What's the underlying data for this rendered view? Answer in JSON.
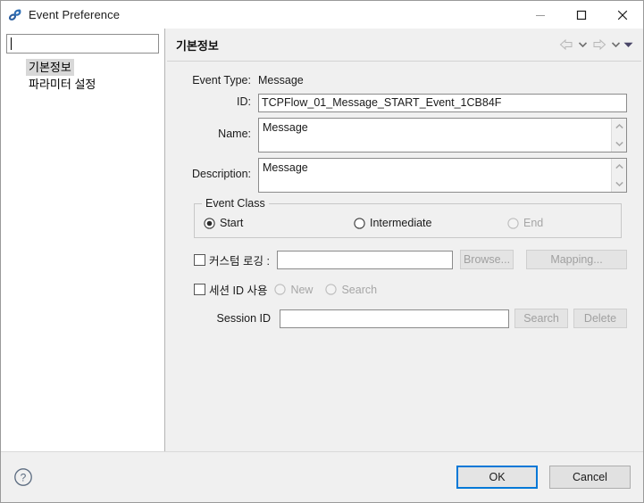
{
  "window": {
    "title": "Event Preference",
    "app_icon": "links-icon",
    "controls": {
      "minimize": "minimize-icon",
      "maximize": "maximize-icon",
      "close": "close-icon"
    }
  },
  "sidebar": {
    "filter_value": "",
    "filter_placeholder": "",
    "items": [
      {
        "label": "기본정보",
        "selected": true
      },
      {
        "label": "파라미터 설정",
        "selected": false
      }
    ]
  },
  "content": {
    "header_title": "기본정보",
    "nav": {
      "back": "back-arrow-icon",
      "back_menu": "chevron-down-icon",
      "forward": "forward-arrow-icon",
      "forward_menu": "chevron-down-icon",
      "more_menu": "chevron-down-filled-icon"
    },
    "fields": {
      "event_type_label": "Event Type:",
      "event_type_value": "Message",
      "id_label": "ID:",
      "id_value": "TCPFlow_01_Message_START_Event_1CB84F",
      "name_label": "Name:",
      "name_value": "Message",
      "description_label": "Description:",
      "description_value": "Message"
    },
    "event_class": {
      "legend": "Event Class",
      "options": [
        {
          "label": "Start",
          "selected": true,
          "disabled": false
        },
        {
          "label": "Intermediate",
          "selected": false,
          "disabled": false
        },
        {
          "label": "End",
          "selected": false,
          "disabled": true
        }
      ]
    },
    "custom_logging": {
      "checkbox_label": "커스텀 로깅 :",
      "checked": false,
      "input_value": "",
      "browse_label": "Browse...",
      "browse_disabled": true,
      "mapping_label": "Mapping...",
      "mapping_disabled": true
    },
    "session": {
      "checkbox_label": "세션 ID 사용",
      "checked": false,
      "radios": [
        {
          "label": "New",
          "selected": false,
          "disabled": true
        },
        {
          "label": "Search",
          "selected": false,
          "disabled": true
        }
      ],
      "id_label": "Session ID",
      "id_value": "",
      "search_label": "Search",
      "search_disabled": true,
      "delete_label": "Delete",
      "delete_disabled": true
    }
  },
  "footer": {
    "help_icon": "help-circle-icon",
    "ok_label": "OK",
    "cancel_label": "Cancel"
  },
  "colors": {
    "accent": "#0078d7",
    "panel_bg": "#f0f0f0",
    "selection": "#d8d8d8",
    "disabled_text": "#a0a0a0"
  }
}
